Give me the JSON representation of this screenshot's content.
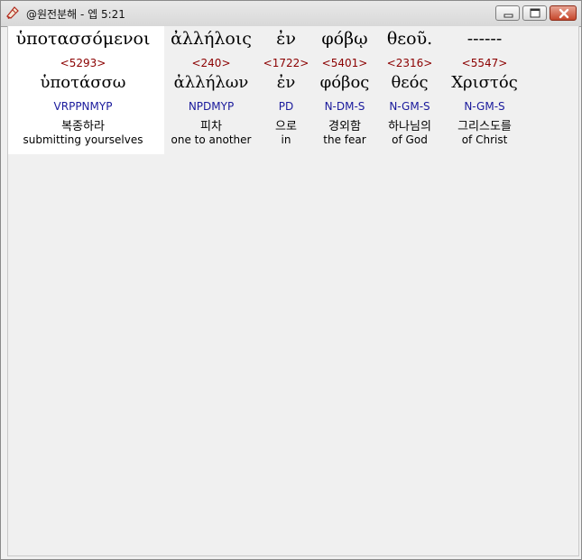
{
  "window": {
    "title": "@원전분해 - 엡 5:21"
  },
  "words": [
    {
      "greek": "ὑποτασσόμενοι",
      "strong": "<5293>",
      "lemma": "ὑποτάσσω",
      "parse": "VRPPNMYP",
      "korean": "복종하라",
      "english": "submitting yourselves"
    },
    {
      "greek": "ἀλλήλοις",
      "strong": "<240>",
      "lemma": "ἀλλήλων",
      "parse": "NPDMYP",
      "korean": "피차",
      "english": "one to another"
    },
    {
      "greek": "ἐν",
      "strong": "<1722>",
      "lemma": "ἐν",
      "parse": "PD",
      "korean": "으로",
      "english": "in"
    },
    {
      "greek": "φόβῳ",
      "strong": "<5401>",
      "lemma": "φόβος",
      "parse": "N-DM-S",
      "korean": "경외함",
      "english": "the fear"
    },
    {
      "greek": "θεοῦ.",
      "strong": "<2316>",
      "lemma": "θεός",
      "parse": "N-GM-S",
      "korean": "하나님의",
      "english": "of God"
    },
    {
      "greek": "------",
      "strong": "<5547>",
      "lemma": "Χριστός",
      "parse": "N-GM-S",
      "korean": "그리스도를",
      "english": "of Christ"
    }
  ],
  "colors": {
    "strong": "#8b0000",
    "parse": "#1a1a9c",
    "highlight": "#ffffff"
  },
  "icons": [
    "app-icon",
    "minimize-icon",
    "maximize-icon",
    "close-icon"
  ]
}
